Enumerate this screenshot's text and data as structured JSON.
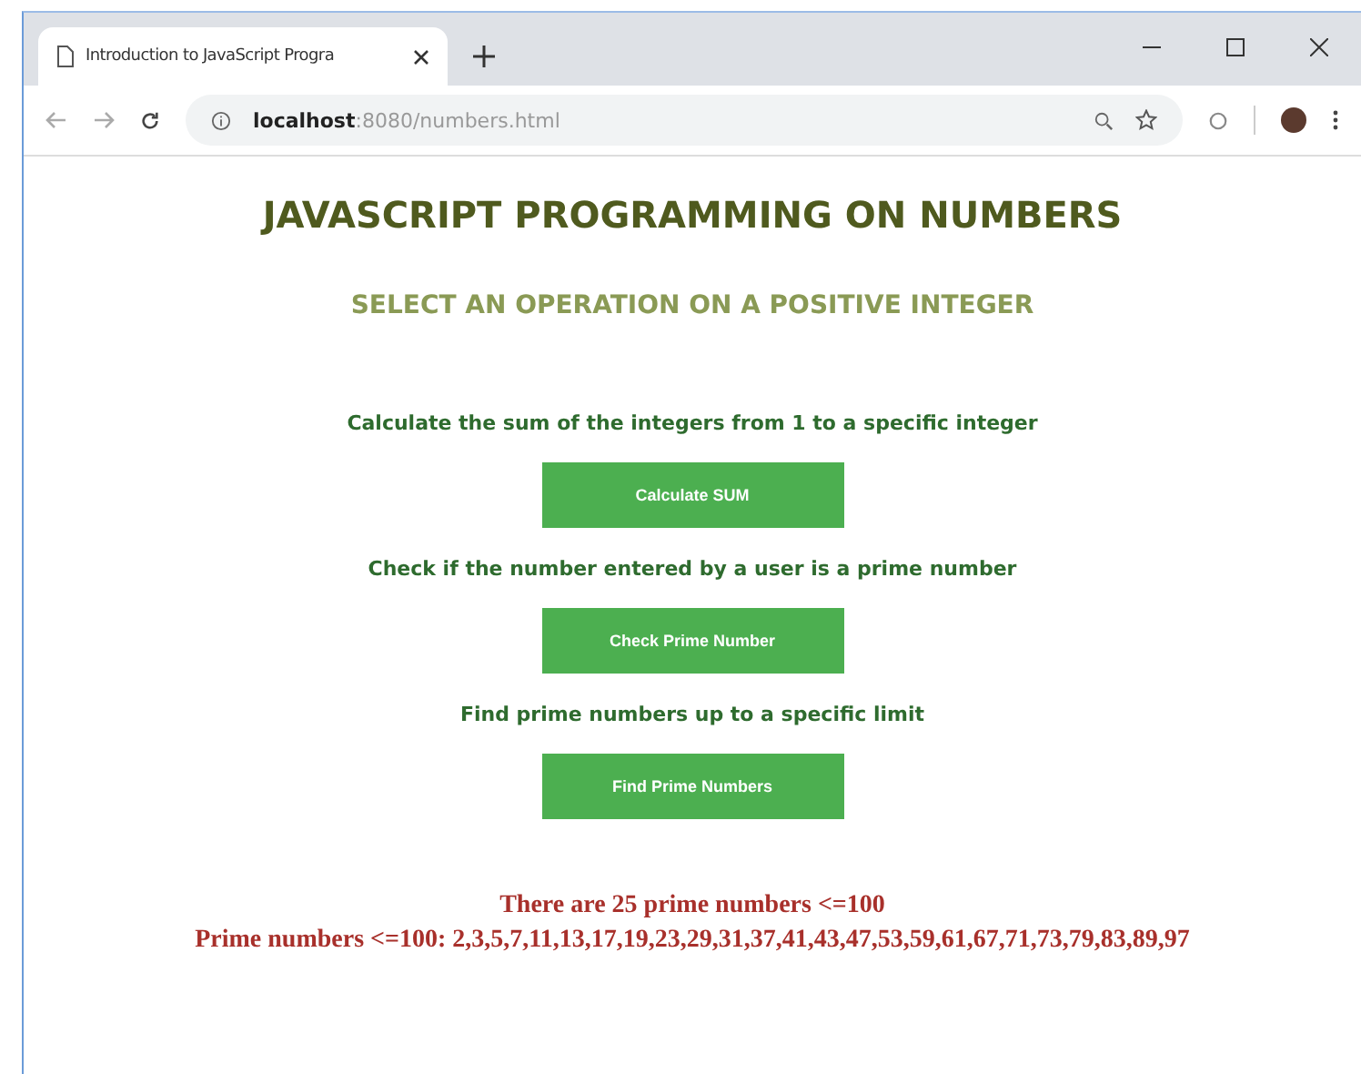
{
  "browser": {
    "tab_title": "Introduction to JavaScript Progra",
    "address": "**localhost**:8080/numbers.html"
  },
  "page": {
    "title": "JAVASCRIPT PROGRAMMING ON NUMBERS",
    "subtitle": "SELECT AN OPERATION ON A POSITIVE INTEGER",
    "operations": [
      {
        "description": "Calculate the sum of the integers from 1 to a specific integer",
        "button": "Calculate SUM"
      },
      {
        "description": "Check if the number entered by a user is a prime number",
        "button": "Check Prime Number"
      },
      {
        "description": "Find prime numbers up to a specific limit",
        "button": "Find Prime Numbers"
      }
    ],
    "results": [
      "There are 25 prime numbers <=100",
      "Prime numbers <=100: 2,3,5,7,11,13,17,19,23,29,31,37,41,43,47,53,59,61,67,71,73,79,83,89,97"
    ]
  }
}
